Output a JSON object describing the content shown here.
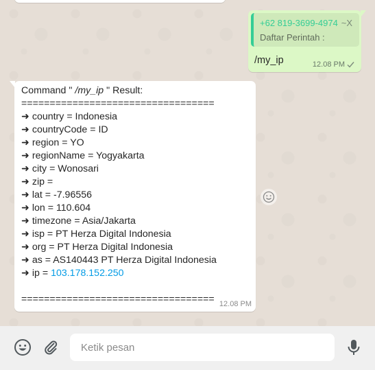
{
  "conversation": {
    "outgoing": {
      "quote_author": "+62 819-3699-4974",
      "quote_suffix": "~X",
      "quote_text": "Daftar Perintah :",
      "text": "/my_ip",
      "time": "12.08 PM",
      "status_icon": "double-check-icon"
    },
    "incoming": {
      "header_prefix": "Command \"",
      "header_command": "/my_ip",
      "header_suffix": "\" Result:",
      "separator": "==================================",
      "arrow": "➜",
      "fields": [
        {
          "key": "country",
          "value": "Indonesia"
        },
        {
          "key": "countryCode",
          "value": "ID"
        },
        {
          "key": "region",
          "value": "YO"
        },
        {
          "key": "regionName",
          "value": "Yogyakarta"
        },
        {
          "key": "city",
          "value": "Wonosari"
        },
        {
          "key": "zip",
          "value": ""
        },
        {
          "key": "lat",
          "value": "-7.96556"
        },
        {
          "key": "lon",
          "value": "110.604"
        },
        {
          "key": "timezone",
          "value": "Asia/Jakarta"
        },
        {
          "key": "isp",
          "value": "PT Herza Digital Indonesia"
        },
        {
          "key": "org",
          "value": "PT Herza Digital Indonesia"
        },
        {
          "key": "as",
          "value": "AS140443 PT Herza Digital Indonesia"
        }
      ],
      "ip_key": "ip",
      "ip_value": "103.178.152.250",
      "time": "12.08 PM"
    }
  },
  "composer": {
    "placeholder": "Ketik pesan",
    "emoji_icon": "emoji-icon",
    "attach_icon": "paperclip-icon",
    "mic_icon": "microphone-icon"
  },
  "colors": {
    "outgoing_bubble": "#dcf8c6",
    "incoming_bubble": "#ffffff",
    "quote_accent": "#35cd96",
    "link": "#039be5",
    "footer_bg": "#f0f0f0"
  }
}
